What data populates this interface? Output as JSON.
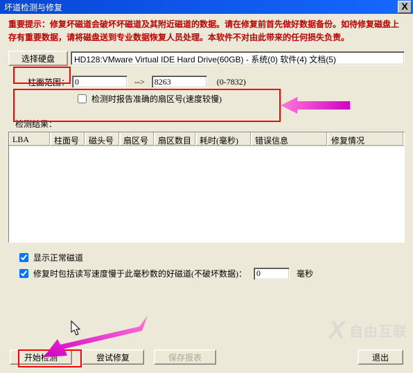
{
  "window": {
    "title": "坏道检测与修复",
    "close": "X"
  },
  "warning": "重要提示：修复坏磁道会破坏坏磁道及其附近磁道的数据。请在修复前首先做好数据备份。如待修复磁盘上存有重要数据，请将磁盘送到专业数据恢复人员处理。本软件不对由此带来的任何损失负责。",
  "disk": {
    "select_btn": "选择硬盘",
    "text": "HD128:VMware Virtual IDE Hard Drive(60GB) - 系统(0) 软件(4) 文档(5)"
  },
  "range": {
    "label": "柱面范围：",
    "from": "0",
    "arrow": "-->",
    "to": "8263",
    "hint": "(0-7832)",
    "report_cb_label": "检测时报告准确的扇区号(速度较慢)"
  },
  "result_label": "检测结果：",
  "columns": {
    "c0": "LBA",
    "c1": "柱面号",
    "c2": "磁头号",
    "c3": "扇区号",
    "c4": "扇区数目",
    "c5": "耗时(毫秒)",
    "c6": "错误信息",
    "c7": "修复情况"
  },
  "options": {
    "show_normal": "显示正常磁道",
    "repair_slow": "修复时包括读写速度慢于此毫秒数的好磁道(不破坏数据)：",
    "ms_value": "0",
    "ms_unit": "毫秒"
  },
  "buttons": {
    "start": "开始检测",
    "try_repair": "尝试修复",
    "save_report": "保存报表",
    "exit": "退出"
  },
  "watermark": "自由互联"
}
